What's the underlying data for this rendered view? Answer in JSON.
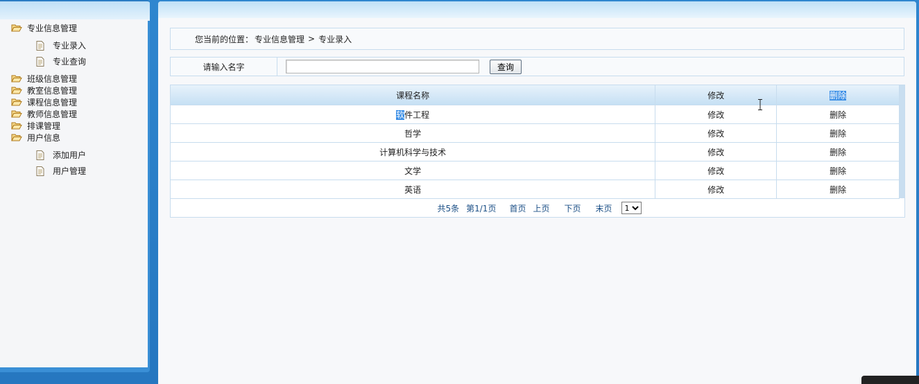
{
  "sidebar": {
    "groups": [
      {
        "label": "专业信息管理",
        "items": [
          "专业录入",
          "专业查询"
        ]
      },
      {
        "label": "班级信息管理"
      },
      {
        "label": "教室信息管理"
      },
      {
        "label": "课程信息管理"
      },
      {
        "label": "教师信息管理"
      },
      {
        "label": "排课管理"
      },
      {
        "label": "用户信息",
        "items": [
          "添加用户",
          "用户管理"
        ]
      }
    ]
  },
  "breadcrumb": {
    "prefix": "您当前的位置：",
    "section": "专业信息管理",
    "separator": ">",
    "current": "专业录入"
  },
  "search": {
    "label": "请输入名字",
    "value": "",
    "button": "查询"
  },
  "table": {
    "headers": [
      "课程名称",
      "修改",
      "删除"
    ],
    "rows": [
      {
        "name_hl": "软",
        "name_rest": "件工程",
        "edit": "修改",
        "delete": "删除"
      },
      {
        "name": "哲学",
        "edit": "修改",
        "delete": "删除"
      },
      {
        "name": "计算机科学与技术",
        "edit": "修改",
        "delete": "删除"
      },
      {
        "name": "文学",
        "edit": "修改",
        "delete": "删除"
      },
      {
        "name": "英语",
        "edit": "修改",
        "delete": "删除"
      }
    ]
  },
  "pager": {
    "total": "共5条",
    "page": "第1/1页",
    "first": "首页",
    "prev": "上页",
    "next": "下页",
    "last": "末页",
    "select_value": "1"
  },
  "colors": {
    "frame_blue": "#2a7cc4",
    "border": "#c7dcee",
    "pager_text": "#1b4f86",
    "selection": "#3a8ee6"
  }
}
